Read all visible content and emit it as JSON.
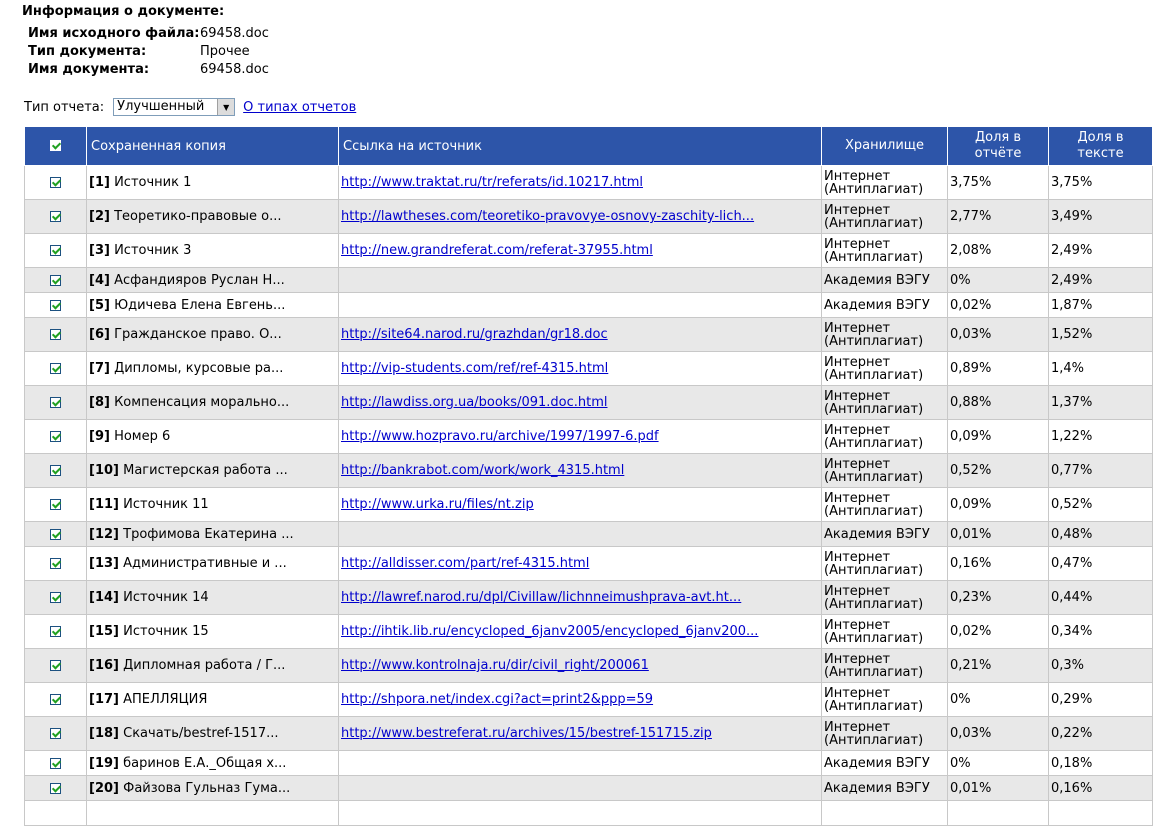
{
  "info": {
    "heading": "Информация о документе:",
    "rows": [
      {
        "label": "Имя исходного файла:",
        "value": "69458.doc"
      },
      {
        "label": "Тип документа:",
        "value": "Прочее"
      },
      {
        "label": "Имя документа:",
        "value": "69458.doc"
      }
    ]
  },
  "report": {
    "label": "Тип отчета:",
    "selected": "Улучшенный",
    "about_link": "О типах отчетов"
  },
  "table": {
    "columns": {
      "saved_copy": "Сохраненная копия",
      "source_link": "Ссылка на источник",
      "storage": "Хранилище",
      "share_report": "Доля в отчёте",
      "share_text": "Доля в тексте"
    },
    "rows": [
      {
        "index": "[1]",
        "name": "Источник 1",
        "link": "http://www.traktat.ru/tr/referats/id.10217.html",
        "storage": "Интернет (Антиплагиат)",
        "share_report": "3,75%",
        "share_text": "3,75%"
      },
      {
        "index": "[2]",
        "name": "Теоретико-правовые о...",
        "link": "http://lawtheses.com/teoretiko-pravovye-osnovy-zaschity-lich...",
        "storage": "Интернет (Антиплагиат)",
        "share_report": "2,77%",
        "share_text": "3,49%"
      },
      {
        "index": "[3]",
        "name": "Источник 3",
        "link": "http://new.grandreferat.com/referat-37955.html",
        "storage": "Интернет (Антиплагиат)",
        "share_report": "2,08%",
        "share_text": "2,49%"
      },
      {
        "index": "[4]",
        "name": "Асфандияров Руслан Н...",
        "link": "",
        "storage": "Академия ВЭГУ",
        "share_report": "0%",
        "share_text": "2,49%"
      },
      {
        "index": "[5]",
        "name": "Юдичева Елена Евгень...",
        "link": "",
        "storage": "Академия ВЭГУ",
        "share_report": "0,02%",
        "share_text": "1,87%"
      },
      {
        "index": "[6]",
        "name": "Гражданское право. О...",
        "link": "http://site64.narod.ru/grazhdan/gr18.doc",
        "storage": "Интернет (Антиплагиат)",
        "share_report": "0,03%",
        "share_text": "1,52%"
      },
      {
        "index": "[7]",
        "name": "Дипломы, курсовые ра...",
        "link": "http://vip-students.com/ref/ref-4315.html",
        "storage": "Интернет (Антиплагиат)",
        "share_report": "0,89%",
        "share_text": "1,4%"
      },
      {
        "index": "[8]",
        "name": "Компенсация морально...",
        "link": "http://lawdiss.org.ua/books/091.doc.html",
        "storage": "Интернет (Антиплагиат)",
        "share_report": "0,88%",
        "share_text": "1,37%"
      },
      {
        "index": "[9]",
        "name": "Номер 6",
        "link": "http://www.hozpravo.ru/archive/1997/1997-6.pdf",
        "storage": "Интернет (Антиплагиат)",
        "share_report": "0,09%",
        "share_text": "1,22%"
      },
      {
        "index": "[10]",
        "name": "Магистерская работа ...",
        "link": "http://bankrabot.com/work/work_4315.html",
        "storage": "Интернет (Антиплагиат)",
        "share_report": "0,52%",
        "share_text": "0,77%"
      },
      {
        "index": "[11]",
        "name": "Источник 11",
        "link": "http://www.urka.ru/files/nt.zip",
        "storage": "Интернет (Антиплагиат)",
        "share_report": "0,09%",
        "share_text": "0,52%"
      },
      {
        "index": "[12]",
        "name": "Трофимова Екатерина ...",
        "link": "",
        "storage": "Академия ВЭГУ",
        "share_report": "0,01%",
        "share_text": "0,48%"
      },
      {
        "index": "[13]",
        "name": "Административные и ...",
        "link": "http://alldisser.com/part/ref-4315.html",
        "storage": "Интернет (Антиплагиат)",
        "share_report": "0,16%",
        "share_text": "0,47%"
      },
      {
        "index": "[14]",
        "name": "Источник 14",
        "link": "http://lawref.narod.ru/dpl/Civillaw/lichnneimushprava-avt.ht...",
        "storage": "Интернет (Антиплагиат)",
        "share_report": "0,23%",
        "share_text": "0,44%"
      },
      {
        "index": "[15]",
        "name": "Источник 15",
        "link": "http://ihtik.lib.ru/encycloped_6janv2005/encycloped_6janv200...",
        "storage": "Интернет (Антиплагиат)",
        "share_report": "0,02%",
        "share_text": "0,34%"
      },
      {
        "index": "[16]",
        "name": "Дипломная работа / Г...",
        "link": "http://www.kontrolnaja.ru/dir/civil_right/200061",
        "storage": "Интернет (Антиплагиат)",
        "share_report": "0,21%",
        "share_text": "0,3%"
      },
      {
        "index": "[17]",
        "name": "АПЕЛЛЯЦИЯ",
        "link": "http://shpora.net/index.cgi?act=print2&ppp=59",
        "storage": "Интернет (Антиплагиат)",
        "share_report": "0%",
        "share_text": "0,29%"
      },
      {
        "index": "[18]",
        "name": "Скачать/bestref-1517...",
        "link": "http://www.bestreferat.ru/archives/15/bestref-151715.zip",
        "storage": "Интернет (Антиплагиат)",
        "share_report": "0,03%",
        "share_text": "0,22%"
      },
      {
        "index": "[19]",
        "name": "баринов Е.А._Общая х...",
        "link": "",
        "storage": "Академия ВЭГУ",
        "share_report": "0%",
        "share_text": "0,18%"
      },
      {
        "index": "[20]",
        "name": "Файзова Гульназ Гума...",
        "link": "",
        "storage": "Академия ВЭГУ",
        "share_report": "0,01%",
        "share_text": "0,16%"
      },
      {
        "index": "",
        "name": "",
        "link": "",
        "storage": "",
        "share_report": "",
        "share_text": ""
      }
    ]
  }
}
